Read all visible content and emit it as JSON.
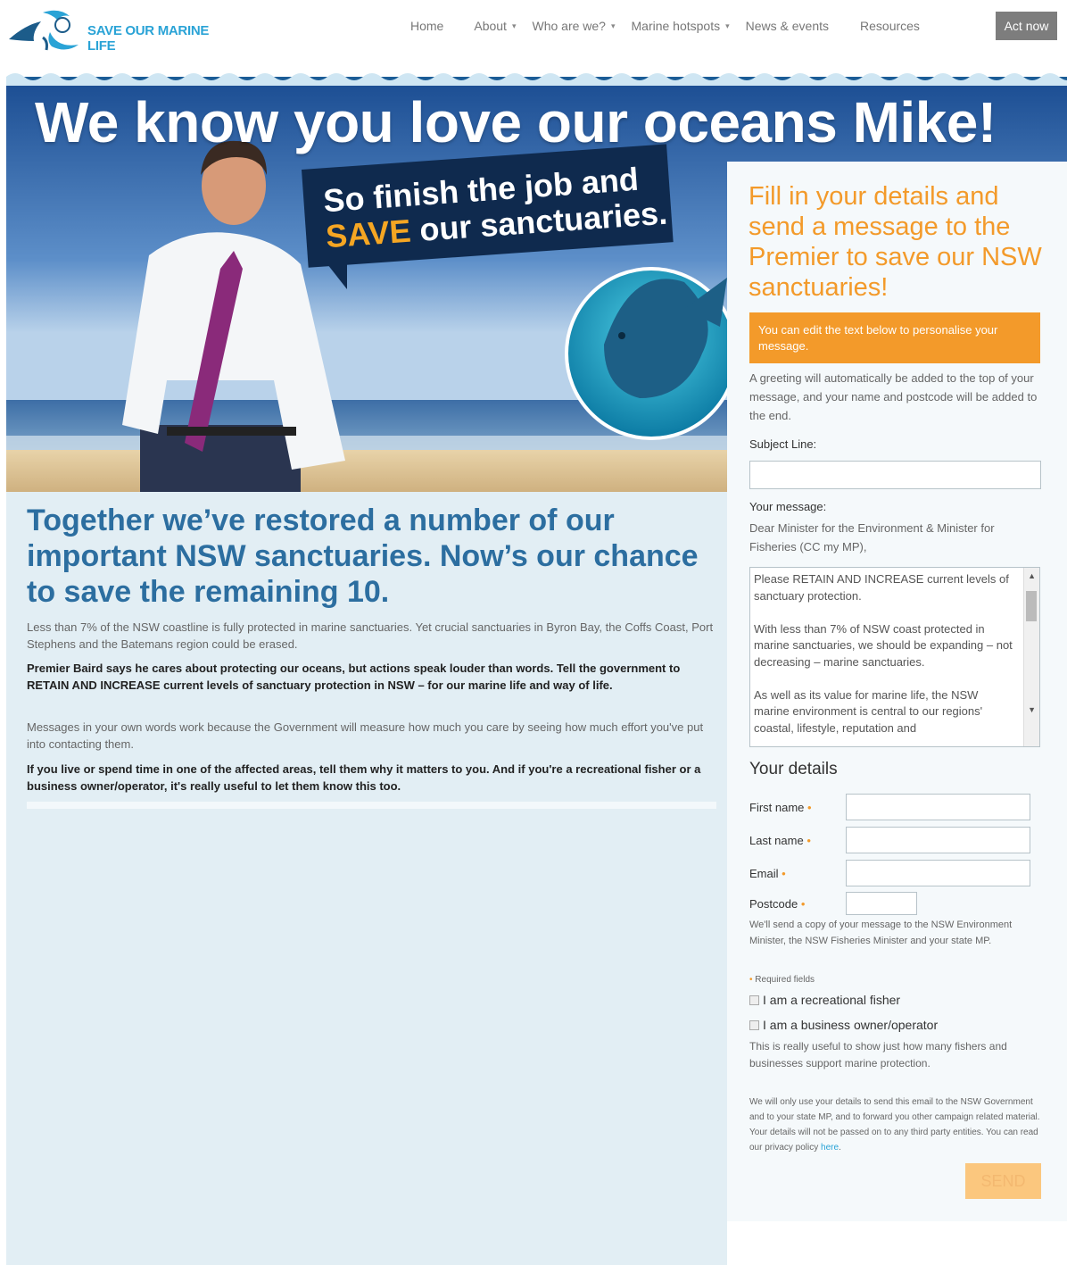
{
  "header": {
    "logo_text": "SAVE OUR MARINE LIFE",
    "nav": [
      {
        "label": "Home",
        "caret": false
      },
      {
        "label": "About",
        "caret": true
      },
      {
        "label": "Who are we?",
        "caret": true
      },
      {
        "label": "Marine hotspots",
        "caret": true
      },
      {
        "label": "News & events",
        "caret": false
      },
      {
        "label": "Resources",
        "caret": false
      }
    ],
    "cta_label": "Act now"
  },
  "hero": {
    "title": "We know you love our oceans Mike!",
    "bubble_line1": "So finish the job and",
    "bubble_highlight": "SAVE",
    "bubble_rest": " our sanctuaries."
  },
  "content": {
    "lead": "Together we’ve restored a number of our important NSW sanctuaries. Now’s our chance to save the remaining 10.",
    "p1": "Less than 7% of the NSW coastline is fully protected in marine sanctuaries. Yet crucial sanctuaries in Byron Bay, the Coffs Coast, Port Stephens and the Batemans region could be erased.",
    "p2": "Premier Baird says he cares about protecting our oceans, but actions speak louder than words. Tell the government to RETAIN AND INCREASE current levels of sanctuary protection in NSW – for our marine life and way of life.",
    "p3": "Messages in your own words work because the Government will measure how much you care by seeing how much effort you've put into contacting them.",
    "p4": "If you live or spend time in one of the affected areas, tell them why it matters to you. And if you're a recreational fisher or a business owner/operator, it's really useful to let them know this too."
  },
  "form": {
    "title": "Fill in your details and send a message to the Premier to save our NSW sanctuaries!",
    "note": "You can edit the text below to personalise your message.",
    "greeting_info": "A greeting will automatically be added to the top of your message, and your name and postcode will be added to the end.",
    "subject_label": "Subject Line:",
    "subject_value": "",
    "message_label": "Your message:",
    "message_to": "Dear Minister for the Environment & Minister for Fisheries (CC my MP),",
    "message_text": "Please RETAIN AND INCREASE current levels of sanctuary protection.\n\nWith less than 7% of NSW coast protected in marine sanctuaries, we should be expanding – not decreasing – marine sanctuaries.\n\nAs well as its value for marine life, the NSW marine environment is central to our regions' coastal, lifestyle, reputation and",
    "details_heading": "Your details",
    "first_name_label": "First name",
    "last_name_label": "Last name",
    "email_label": "Email",
    "postcode_label": "Postcode",
    "required_mark": "•",
    "copy_note": "We'll send a copy of your message to the NSW Environment Minister, the NSW Fisheries Minister and your state MP.",
    "required_note": "Required fields",
    "check_fisher": "I am a recreational fisher",
    "check_business": "I am a business owner/operator",
    "check_note": "This is really useful to show just how many fishers and businesses support marine protection.",
    "privacy_text": "We will only use your details to send this email to the NSW Government and to your state MP, and to forward you other campaign related material. Your details will not be passed on to any third party entities. You can read our privacy policy ",
    "privacy_link": "here",
    "privacy_end": ".",
    "send_label": "SEND"
  },
  "colors": {
    "accent_orange": "#f39a2a",
    "heading_blue": "#2c6ea0",
    "logo_blue": "#2aa3d6",
    "navy": "#0f2a4e"
  }
}
